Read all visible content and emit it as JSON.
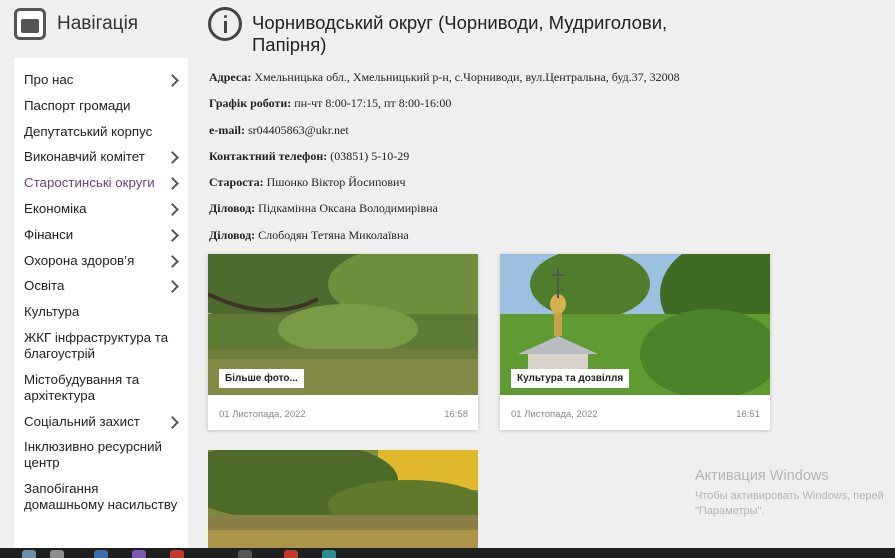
{
  "nav": {
    "title": "Навігація",
    "items": [
      {
        "label": "Про нас",
        "chevron": true
      },
      {
        "label": "Паспорт громади",
        "chevron": false
      },
      {
        "label": "Депутатський корпус",
        "chevron": false
      },
      {
        "label": "Виконавчий комітет",
        "chevron": true
      },
      {
        "label": "Старостинські округи",
        "chevron": true,
        "active": true
      },
      {
        "label": "Економіка",
        "chevron": true
      },
      {
        "label": "Фінанси",
        "chevron": true
      },
      {
        "label": "Охорона здоров’я",
        "chevron": true
      },
      {
        "label": "Освіта",
        "chevron": true
      },
      {
        "label": "Культура",
        "chevron": false
      },
      {
        "label": "ЖКГ інфраструктура та благоустрій",
        "chevron": false
      },
      {
        "label": "Містобудування та архітектура",
        "chevron": false
      },
      {
        "label": "Соціальний захист",
        "chevron": true
      },
      {
        "label": "Інклюзивно ресурсний центр",
        "chevron": false
      },
      {
        "label": "Запобігання домашньому насильству",
        "chevron": false
      }
    ]
  },
  "page": {
    "title": "Чорниводський округ (Чорниводи, Мудриголови, Папірня)"
  },
  "details": [
    {
      "label": "Адреса:",
      "value": "Хмельницька обл., Хмельницький р-н, с.Чорниводи, вул.Центральна, буд.37, 32008"
    },
    {
      "label": "Графік роботи:",
      "value": "пн-чт 8:00-17:15, пт 8:00-16:00"
    },
    {
      "label": "e-mail:",
      "value": "sr04405863@ukr.net"
    },
    {
      "label": "Контактний телефон:",
      "value": "(03851) 5-10-29"
    },
    {
      "label": "Староста:",
      "value": "Пшонко Віктор Йосипович"
    },
    {
      "label": "Діловод:",
      "value": "Підкамінна Оксана Володимирівна"
    },
    {
      "label": "Діловод:",
      "value": "Слободян Тетяна Миколаївна"
    }
  ],
  "cards": [
    {
      "tag": "Більше фото...",
      "date": "01 Листопада, 2022",
      "time": "16:58"
    },
    {
      "tag": "Культура та дозвілля",
      "date": "01 Листопада, 2022",
      "time": "16:51"
    }
  ],
  "watermark": {
    "line1": "Активация Windows",
    "line2": "Чтобы активировать Windows, перей",
    "line3": "\"Параметры\"."
  },
  "colors": {
    "active": "#6a3d8e",
    "background": "#efefef"
  }
}
